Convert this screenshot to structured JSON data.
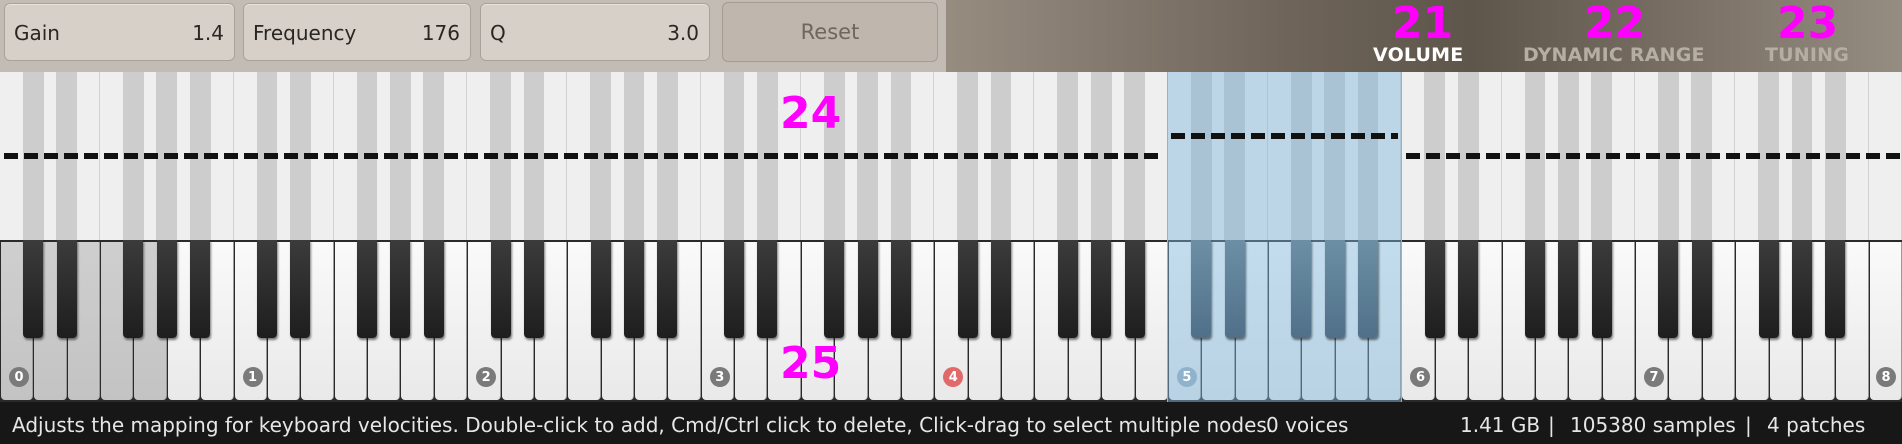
{
  "params": [
    {
      "label": "Gain",
      "value": "1.4"
    },
    {
      "label": "Frequency",
      "value": "176"
    },
    {
      "label": "Q",
      "value": "3.0"
    }
  ],
  "reset_label": "Reset",
  "tabs": [
    {
      "label": "VOLUME",
      "active": true,
      "callout": "21"
    },
    {
      "label": "DYNAMIC RANGE",
      "active": false,
      "callout": "22"
    },
    {
      "label": "TUNING",
      "active": false,
      "callout": "23"
    }
  ],
  "callouts": {
    "mapping": "24",
    "keyboard": "25"
  },
  "octaves": [
    "0",
    "1",
    "2",
    "3",
    "4",
    "5",
    "6",
    "7",
    "8"
  ],
  "octave_colors": {
    "default": "#7a7a7a",
    "highlight": "#e06a6a",
    "selected": "#8fb3cc"
  },
  "status": {
    "hint": "Adjusts the mapping for keyboard velocities. Double-click to add, Cmd/Ctrl click to delete, Click-drag to select multiple nodes.",
    "voices": "0 voices",
    "memory": "1.41 GB",
    "samples": "105380 samples",
    "patches": "4 patches",
    "separator": "|"
  }
}
